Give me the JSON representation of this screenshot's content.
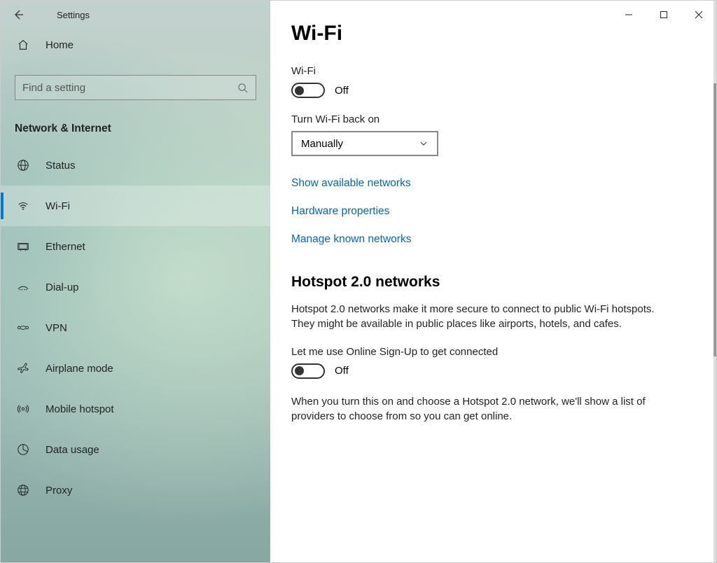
{
  "titlebar": {
    "title": "Settings"
  },
  "sidebar": {
    "home_label": "Home",
    "search_placeholder": "Find a setting",
    "category_title": "Network & Internet",
    "items": [
      {
        "label": "Status"
      },
      {
        "label": "Wi-Fi"
      },
      {
        "label": "Ethernet"
      },
      {
        "label": "Dial-up"
      },
      {
        "label": "VPN"
      },
      {
        "label": "Airplane mode"
      },
      {
        "label": "Mobile hotspot"
      },
      {
        "label": "Data usage"
      },
      {
        "label": "Proxy"
      }
    ]
  },
  "content": {
    "page_title": "Wi-Fi",
    "wifi_label": "Wi-Fi",
    "wifi_state": "Off",
    "turn_back_on_label": "Turn Wi-Fi back on",
    "turn_back_on_value": "Manually",
    "links": {
      "show_networks": "Show available networks",
      "hardware_props": "Hardware properties",
      "manage_known": "Manage known networks"
    },
    "hotspot": {
      "heading": "Hotspot 2.0 networks",
      "description": "Hotspot 2.0 networks make it more secure to connect to public Wi-Fi hotspots. They might be available in public places like airports, hotels, and cafes.",
      "signup_label": "Let me use Online Sign-Up to get connected",
      "signup_state": "Off",
      "signup_note": "When you turn this on and choose a Hotspot 2.0 network, we'll show a list of providers to choose from so you can get online."
    }
  }
}
